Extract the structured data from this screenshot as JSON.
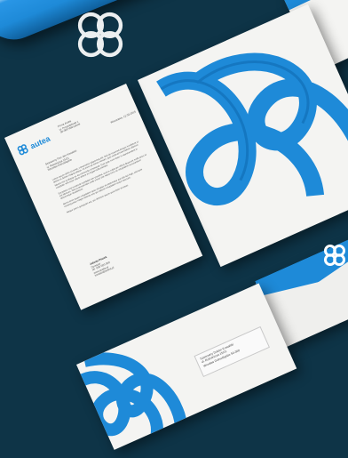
{
  "brand": {
    "name": "autea",
    "accent_color": "#1e8ad8",
    "background_color": "#0e3447",
    "logo_icon": "quatrefoil-knot-icon"
  },
  "letterhead": {
    "sender_block": [
      "Firma Autea",
      "ul. Przykladowa 1",
      "00-000 Warszawa"
    ],
    "date": "Warszawa, 12.03.2015",
    "recipient": [
      "Szanowny Pan Jan Kowalski",
      "ul. Robotnicza 15/21",
      "Wrocław Dolnośląskie"
    ],
    "body_paragraphs": [
      "Lorem ipsum dolor sit amet, consectetur adipiscing elit. Sed do eiusmod tempor incididunt ut labore et dolore magna aliqua. Ut enim ad minim veniam, quis nostrud exercitation ullamco laboris nisi ut aliquip ex ea commodo consequat. Duis aute irure dolor in reprehenderit in voluptate velit esse cillum dolore eu fugiat nulla pariatur.",
      "Excepteur sint occaecat cupidatat non proident, sunt in culpa qui officia deserunt mollit anim id est laborum. Sed ut perspiciatis unde omnis iste natus error sit voluptatem accusantium doloremque laudantium.",
      "Nemo enim ipsam voluptatem quia voluptas sit aspernatur aut odit aut fugit, sed quia consequuntur magni dolores eos qui ratione voluptatem sequi nesciunt.",
      "Neque porro quisquam est, qui dolorem ipsum quia dolor sit amet."
    ],
    "signature_block": [
      "Jolanta Piasek",
      "Dyrektor",
      "tel. 000 000 000",
      "www.autea.pl",
      "kontakt@autea.pl"
    ]
  },
  "envelope_window": {
    "lines": [
      "Szanowny Doktor Kowalski",
      "ul. Robotnicza 15/21",
      "Wrocław Dolnośląskie 50-300"
    ]
  }
}
